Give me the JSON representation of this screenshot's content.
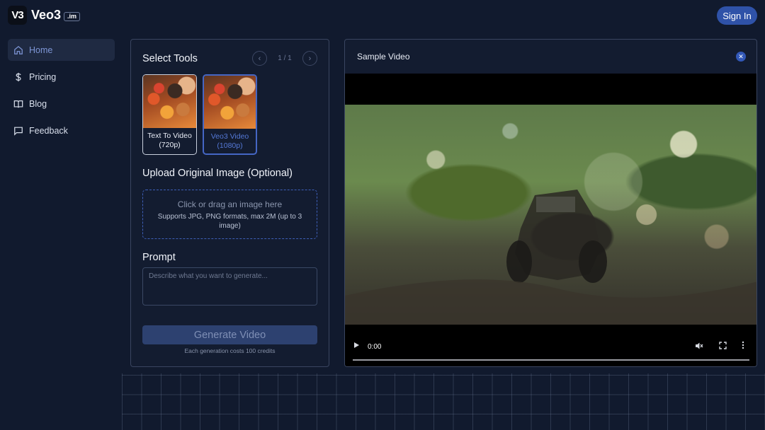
{
  "header": {
    "logo_mark": "V3",
    "brand": "Veo3",
    "brand_badge": ".im",
    "signin_label": "Sign In"
  },
  "sidebar": {
    "items": [
      {
        "label": "Home",
        "icon": "home-icon",
        "active": true
      },
      {
        "label": "Pricing",
        "icon": "dollar-icon",
        "active": false
      },
      {
        "label": "Blog",
        "icon": "book-icon",
        "active": false
      },
      {
        "label": "Feedback",
        "icon": "message-icon",
        "active": false
      }
    ]
  },
  "tools": {
    "title": "Select Tools",
    "pager": "1 / 1",
    "cards": [
      {
        "label": "Text To Video (720p)",
        "selected": false
      },
      {
        "label": "Veo3 Video (1080p)",
        "selected": true
      }
    ]
  },
  "upload": {
    "title": "Upload Original Image (Optional)",
    "main": "Click or drag an image here",
    "sub": "Supports JPG, PNG formats, max 2M (up to 3 image)"
  },
  "prompt": {
    "title": "Prompt",
    "placeholder": "Describe what you want to generate..."
  },
  "generate": {
    "label": "Generate Video",
    "cost_note": "Each generation costs 100 credits"
  },
  "video": {
    "title": "Sample Video",
    "close_icon": "close-icon",
    "time": "0:00",
    "progress": 0
  },
  "colors": {
    "background": "#111a2e",
    "accent": "#2f52a8",
    "selected_border": "#4566c4"
  }
}
